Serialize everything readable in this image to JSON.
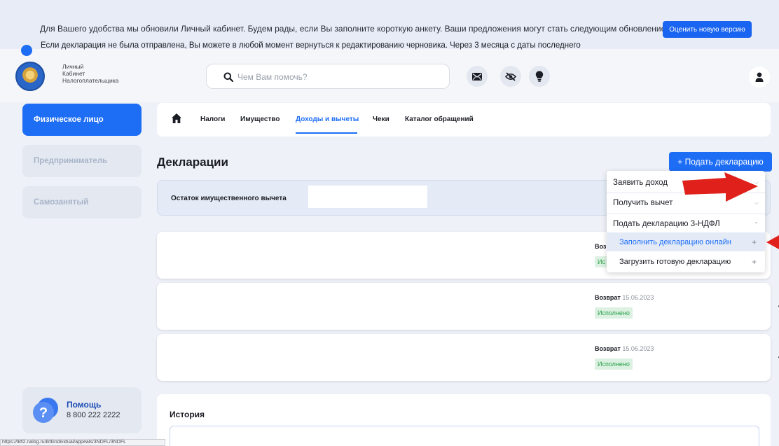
{
  "banner": {
    "text": "Для Вашего удобства мы обновили Личный кабинет. Будем рады, если Вы заполните короткую анкету. Ваши предложения могут стать следующим обновлением",
    "button_label": "Оценить новую версию"
  },
  "header": {
    "logo_line1": "Личный",
    "logo_line2": "Кабинет",
    "logo_line3": "Налогоплательщика",
    "search_placeholder": "Чем Вам помочь?",
    "icons": [
      "mail-icon",
      "eye-off-icon",
      "lightbulb-icon",
      "user-icon"
    ]
  },
  "sidebar": {
    "items": [
      {
        "label": "Физическое лицо",
        "active": true
      },
      {
        "label": "Предприниматель",
        "active": false
      },
      {
        "label": "Самозанятый",
        "active": false
      }
    ],
    "help_title": "Помощь",
    "help_phone": "8 800 222 2222"
  },
  "nav": {
    "tabs": [
      {
        "label": "Налоги",
        "active": false
      },
      {
        "label": "Имущество",
        "active": false
      },
      {
        "label": "Доходы и вычеты",
        "active": true
      },
      {
        "label": "Чеки",
        "active": false
      },
      {
        "label": "Каталог обращений",
        "active": false
      }
    ]
  },
  "main": {
    "title": "Декларации",
    "submit_button": "+ Подать декларацию",
    "balance_label": "Остаток имущественного вычета",
    "declarations": [
      {
        "type": "Возв",
        "date": "",
        "status": "Ис"
      },
      {
        "type": "Возврат",
        "date": "15.06.2023",
        "status": "Исполнено"
      },
      {
        "type": "Возврат",
        "date": "15.06.2023",
        "status": "Исполнено"
      }
    ]
  },
  "history": {
    "title": "История",
    "note": "Если декларация не была отправлена, Вы можете в любой момент вернуться к редактированию черновика. Через 3 месяца с даты последнего"
  },
  "dropdown": {
    "item1": "Заявить доход",
    "item2": "Получить вычет",
    "item3": "Подать декларацию 3-НДФЛ",
    "sub1": "Заполнить декларацию онлайн",
    "sub2": "Загрузить готовую декларацию",
    "chev_down": "⌵",
    "chev_up": "⌃",
    "plus": "+"
  },
  "status_bar": {
    "url": "https://lkfl2.nalog.ru/lkfl/individual/appeals/3NDFL/3NDFL"
  },
  "colors": {
    "accent": "#1e6ef5",
    "status_green": "#27a046",
    "arrow_red": "#e0201b"
  }
}
